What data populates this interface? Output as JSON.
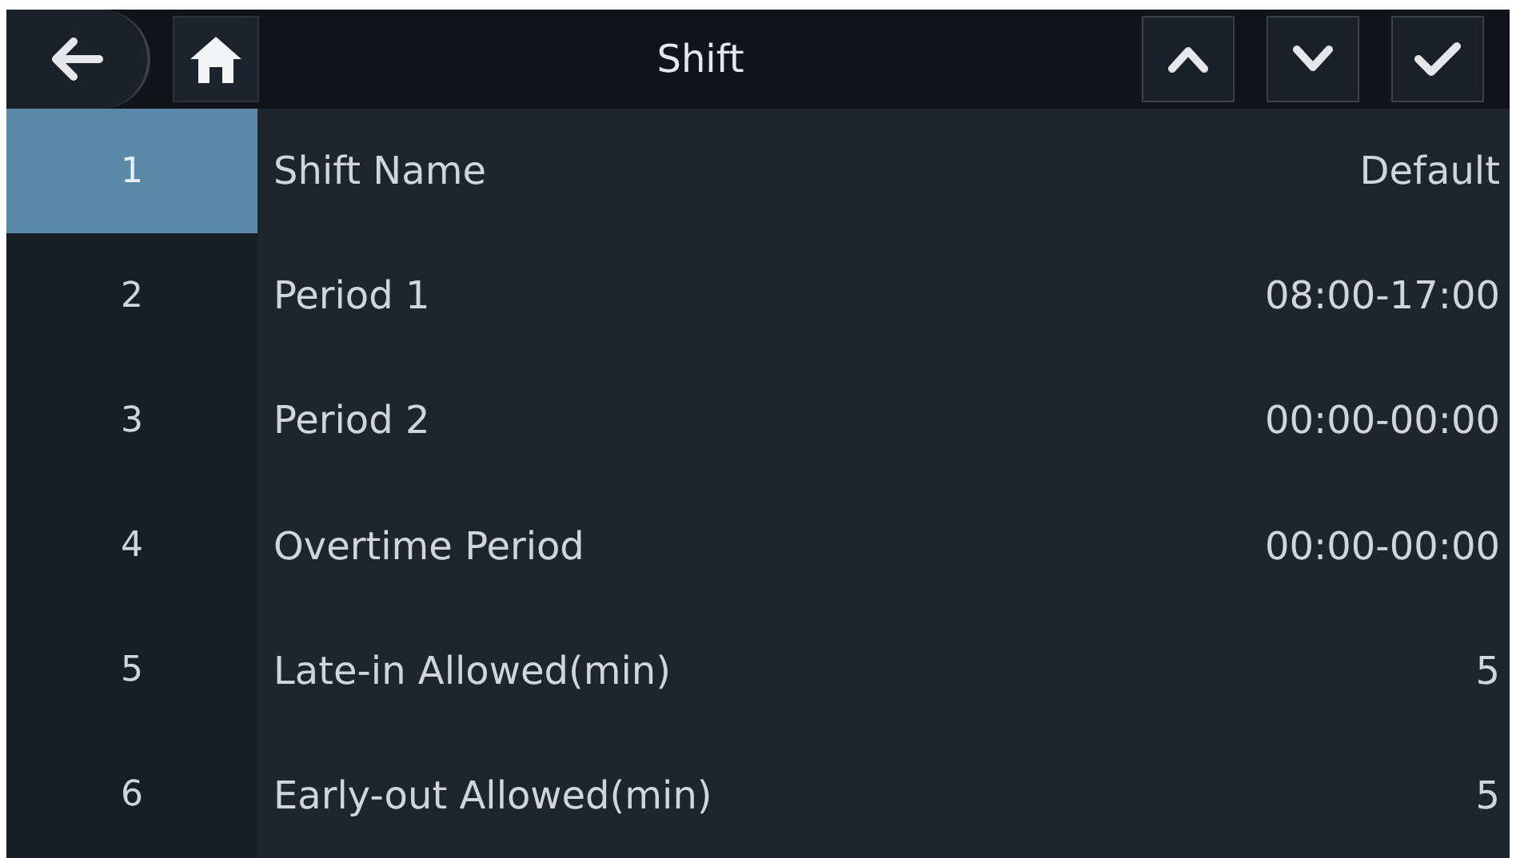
{
  "header": {
    "title": "Shift",
    "buttons": [
      {
        "kind": "up"
      },
      {
        "kind": "down"
      },
      {
        "kind": "confirm"
      }
    ]
  },
  "rows": [
    {
      "number": "1",
      "label": "Shift Name",
      "value": "Default",
      "selected": true
    },
    {
      "number": "2",
      "label": "Period 1",
      "value": "08:00-17:00",
      "selected": false
    },
    {
      "number": "3",
      "label": "Period 2",
      "value": "00:00-00:00",
      "selected": false
    },
    {
      "number": "4",
      "label": "Overtime Period",
      "value": "00:00-00:00",
      "selected": false
    },
    {
      "number": "5",
      "label": "Late-in Allowed(min)",
      "value": "5",
      "selected": false
    },
    {
      "number": "6",
      "label": "Early-out Allowed(min)",
      "value": "5",
      "selected": false
    }
  ]
}
